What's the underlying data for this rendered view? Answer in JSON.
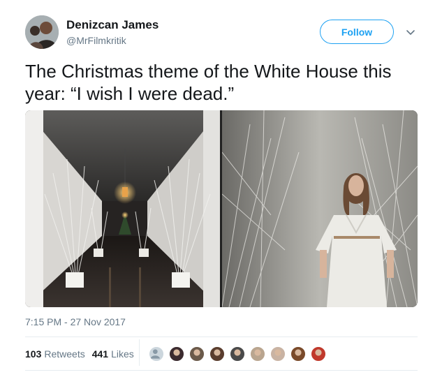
{
  "author": {
    "name": "Denizcan James",
    "handle": "@MrFilmkritik"
  },
  "actions": {
    "follow_label": "Follow",
    "menu_icon": "chevron-down-icon"
  },
  "tweet": {
    "text": "The Christmas theme of the White House this year: “I wish I were dead.”",
    "timestamp": "7:15 PM - 27 Nov 2017"
  },
  "stats": {
    "retweets_count": "103",
    "retweets_label": "Retweets",
    "likes_count": "441",
    "likes_label": "Likes"
  },
  "likers": [
    {
      "avatar": "default-avatar",
      "color": "#8899a6"
    },
    {
      "avatar": "liker-avatar",
      "color": "#3b2b2f"
    },
    {
      "avatar": "liker-avatar",
      "color": "#6b5a4a"
    },
    {
      "avatar": "liker-avatar",
      "color": "#5a3d2e"
    },
    {
      "avatar": "liker-avatar",
      "color": "#4a4a4a"
    },
    {
      "avatar": "liker-avatar",
      "color": "#b9a58f"
    },
    {
      "avatar": "liker-avatar",
      "color": "#c9b3a3"
    },
    {
      "avatar": "liker-avatar",
      "color": "#7a4a2a"
    },
    {
      "avatar": "liker-avatar",
      "color": "#c0392b"
    }
  ],
  "colors": {
    "accent": "#1da1f2",
    "secondary_text": "#657786",
    "divider": "#e6ecf0"
  }
}
